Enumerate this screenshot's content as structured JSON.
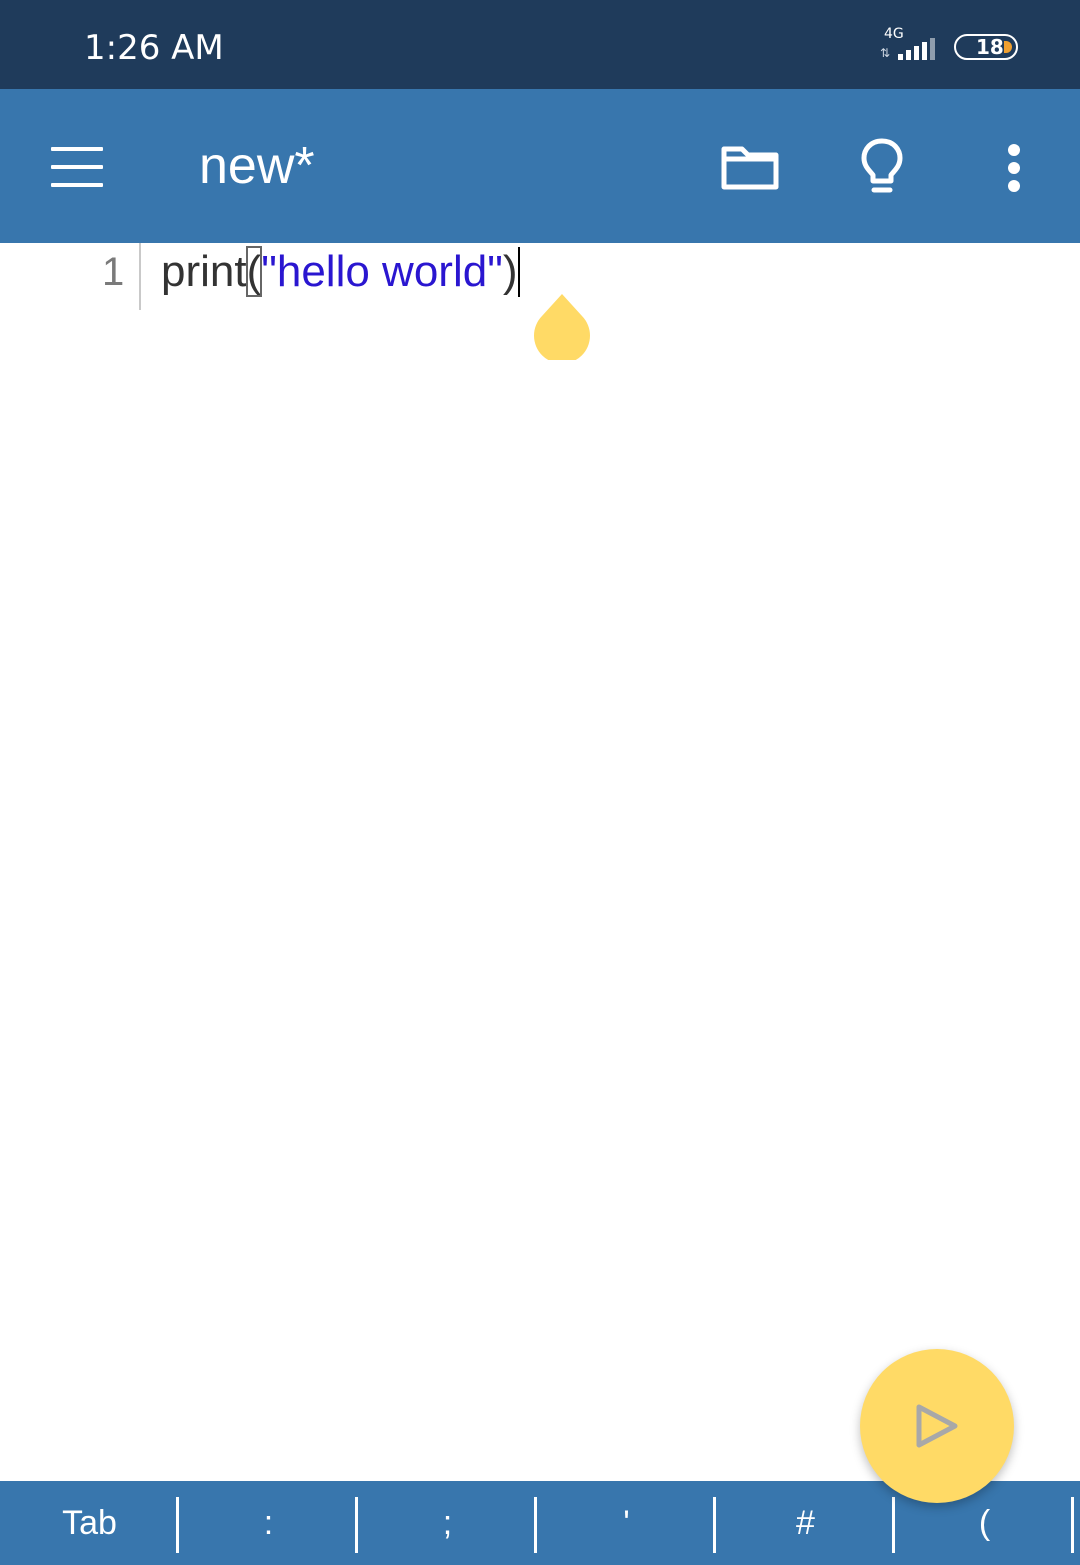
{
  "status_bar": {
    "time": "1:26 AM",
    "network": "4G",
    "battery": "18",
    "battery_color": "#f0a030"
  },
  "app_bar": {
    "title": "new*",
    "menu_icon": "hamburger-menu-icon",
    "actions": [
      {
        "name": "open-folder-icon"
      },
      {
        "name": "lightbulb-icon"
      },
      {
        "name": "more-vertical-icon"
      }
    ],
    "color": "#3876ad"
  },
  "editor": {
    "lines": [
      {
        "number": "1",
        "tokens": {
          "fn": "print",
          "paren_open": "(",
          "string": "\"hello world\"",
          "paren_close": ")"
        }
      }
    ],
    "string_color": "#2a16d0",
    "cursor_handle_color": "#ffda66"
  },
  "run_button": {
    "icon": "play-icon",
    "color": "#ffda66"
  },
  "key_bar": {
    "keys": [
      "Tab",
      ":",
      ";",
      "'",
      "#",
      "("
    ]
  }
}
